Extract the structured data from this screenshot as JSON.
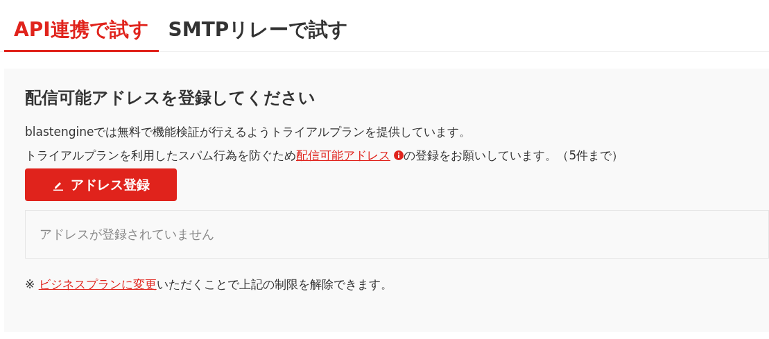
{
  "tabs": [
    {
      "label": "API連携で試す",
      "selected": true
    },
    {
      "label": "SMTPリレーで試す",
      "selected": false
    }
  ],
  "panel": {
    "heading": "配信可能アドレスを登録してください",
    "intro_line": "blastengineでは無料で機能検証が行えるようトライアルプランを提供しています。",
    "notice_before": "トライアルプランを利用したスパム行為を防ぐため",
    "notice_link": "配信可能アドレス",
    "notice_after": "の登録をお願いしています。（5件まで）",
    "register_button": "アドレス登録",
    "address_list": {
      "empty_message": "アドレスが登録されていません"
    },
    "footer_mark": "※",
    "footer_link": "ビジネスプランに変更",
    "footer_after": "いただくことで上記の制限を解除できます。"
  }
}
